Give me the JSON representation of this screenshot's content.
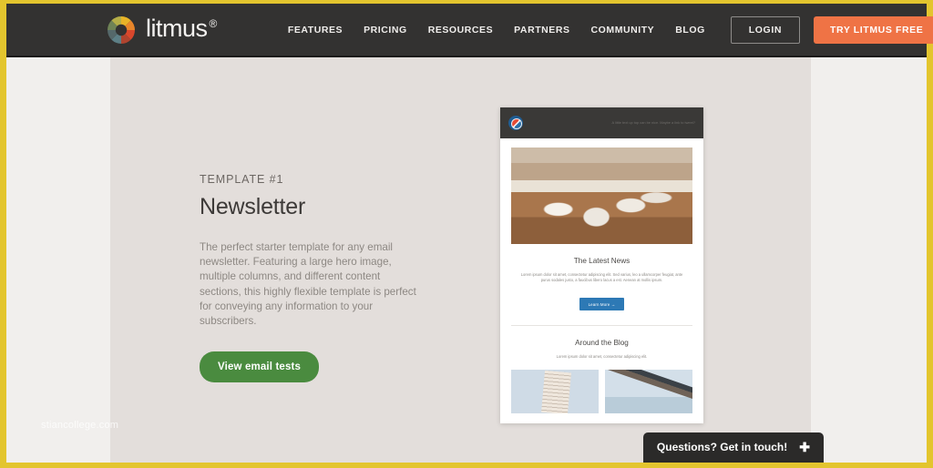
{
  "navbar": {
    "logo_icon": "litmus-color-wheel-icon",
    "brand": "litmus",
    "brand_mark": "®",
    "links": [
      {
        "label": "FEATURES"
      },
      {
        "label": "PRICING"
      },
      {
        "label": "RESOURCES"
      },
      {
        "label": "PARTNERS"
      },
      {
        "label": "COMMUNITY"
      },
      {
        "label": "BLOG"
      }
    ],
    "login_label": "LOGIN",
    "cta_label": "TRY LITMUS FREE",
    "background_color": "#333231",
    "cta_color": "#ef7345"
  },
  "hero": {
    "eyebrow": "TEMPLATE #1",
    "headline": "Newsletter",
    "blurb": "The perfect starter template for any email newsletter. Featuring a large hero image, multiple columns, and different content sections, this highly flexible template is perfect for conveying any information to your subscribers.",
    "cta_label": "View email tests",
    "cta_color": "#4a8b3f"
  },
  "preview": {
    "topbar": {
      "logo_icon": "email-brand-logo-icon",
      "preheader": "A little text up top can be nice. Maybe a link to tweet?"
    },
    "hero_image_alt": "enamel-mugs-on-wooden-table-photo",
    "section_one": {
      "heading": "The Latest News",
      "body": "Lorem ipsum dolor sit amet, consectetur adipiscing elit. Sed varius, leo a ullamcorper feugiat, ante purus sodales justo, a faucibus libero lacus a est. Aenean at mollis ipsum.",
      "button_label": "Learn More →",
      "button_color": "#2d79b5"
    },
    "section_two": {
      "heading": "Around the Blog",
      "body": "Lorem ipsum dolor sit amet, consectetur adipiscing elit.",
      "thumbnails": [
        {
          "alt": "leaning-tower-of-pisa-photo"
        },
        {
          "alt": "suspension-bridge-photo"
        }
      ]
    }
  },
  "watermark": {
    "text": "stiancollege.com"
  },
  "chat": {
    "label": "Questions? Get in touch!",
    "toggle_icon": "plus-icon",
    "toggle_glyph": "✚"
  },
  "frame": {
    "border_color": "#e3c52e"
  }
}
